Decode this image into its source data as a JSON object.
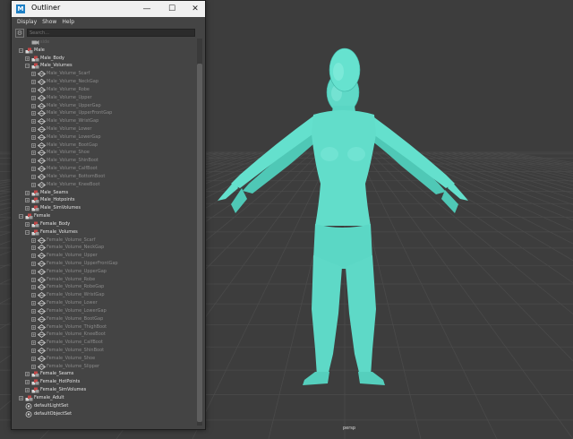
{
  "window": {
    "title": "Outliner",
    "app_icon": "M",
    "minimize_glyph": "—",
    "maximize_glyph": "☐",
    "close_glyph": "✕"
  },
  "menu": [
    "Display",
    "Show",
    "Help"
  ],
  "search": {
    "placeholder": "Search..."
  },
  "tree": [
    {
      "label": "side",
      "depth": 2,
      "icon": "camera-icon",
      "style": "ghost"
    },
    {
      "label": "Male",
      "depth": 1,
      "icon": "group-icon",
      "style": "bright",
      "expander": "-"
    },
    {
      "label": "Male_Body",
      "depth": 2,
      "icon": "group-icon",
      "style": "bright",
      "expander": "+"
    },
    {
      "label": "Male_Volumes",
      "depth": 2,
      "icon": "group-icon",
      "style": "bright",
      "expander": "-"
    },
    {
      "label": "Male_Volume_Scarf",
      "depth": 3,
      "icon": "mesh-icon",
      "style": "dim",
      "expander": "+"
    },
    {
      "label": "Male_Volume_NeckGap",
      "depth": 3,
      "icon": "mesh-icon",
      "style": "dim",
      "expander": "+"
    },
    {
      "label": "Male_Volume_Robe",
      "depth": 3,
      "icon": "mesh-icon",
      "style": "dim",
      "expander": "+"
    },
    {
      "label": "Male_Volume_Upper",
      "depth": 3,
      "icon": "mesh-icon",
      "style": "dim",
      "expander": "+"
    },
    {
      "label": "Male_Volume_UpperGap",
      "depth": 3,
      "icon": "mesh-icon",
      "style": "dim",
      "expander": "+"
    },
    {
      "label": "Male_Volume_UpperFrontGap",
      "depth": 3,
      "icon": "mesh-icon",
      "style": "dim",
      "expander": "+"
    },
    {
      "label": "Male_Volume_WristGap",
      "depth": 3,
      "icon": "mesh-icon",
      "style": "dim",
      "expander": "+"
    },
    {
      "label": "Male_Volume_Lower",
      "depth": 3,
      "icon": "mesh-icon",
      "style": "dim",
      "expander": "+"
    },
    {
      "label": "Male_Volume_LowerGap",
      "depth": 3,
      "icon": "mesh-icon",
      "style": "dim",
      "expander": "+"
    },
    {
      "label": "Male_Volume_BootGap",
      "depth": 3,
      "icon": "mesh-icon",
      "style": "dim",
      "expander": "+"
    },
    {
      "label": "Male_Volume_Shoe",
      "depth": 3,
      "icon": "mesh-icon",
      "style": "dim",
      "expander": "+"
    },
    {
      "label": "Male_Volume_ShinBoot",
      "depth": 3,
      "icon": "mesh-icon",
      "style": "dim",
      "expander": "+"
    },
    {
      "label": "Male_Volume_CalfBoot",
      "depth": 3,
      "icon": "mesh-icon",
      "style": "dim",
      "expander": "+"
    },
    {
      "label": "Male_Volume_BottomBoot",
      "depth": 3,
      "icon": "mesh-icon",
      "style": "dim",
      "expander": "+"
    },
    {
      "label": "Male_Volume_KneeBoot",
      "depth": 3,
      "icon": "mesh-icon",
      "style": "dim",
      "expander": "+"
    },
    {
      "label": "Male_Seams",
      "depth": 2,
      "icon": "group-icon",
      "style": "bright",
      "expander": "+"
    },
    {
      "label": "Male_Hotpoints",
      "depth": 2,
      "icon": "group-icon",
      "style": "bright",
      "expander": "+"
    },
    {
      "label": "Male_SimVolumes",
      "depth": 2,
      "icon": "group-icon",
      "style": "bright",
      "expander": "+"
    },
    {
      "label": "Female",
      "depth": 1,
      "icon": "group-icon",
      "style": "bright",
      "expander": "-"
    },
    {
      "label": "Female_Body",
      "depth": 2,
      "icon": "group-icon",
      "style": "bright",
      "expander": "+"
    },
    {
      "label": "Female_Volumes",
      "depth": 2,
      "icon": "group-icon",
      "style": "bright",
      "expander": "-"
    },
    {
      "label": "Female_Volume_Scarf",
      "depth": 3,
      "icon": "mesh-icon",
      "style": "dim",
      "expander": "+"
    },
    {
      "label": "Female_Volume_NeckGap",
      "depth": 3,
      "icon": "mesh-icon",
      "style": "dim",
      "expander": "+"
    },
    {
      "label": "Female_Volume_Upper",
      "depth": 3,
      "icon": "mesh-icon",
      "style": "dim",
      "expander": "+"
    },
    {
      "label": "Female_Volume_UpperFrontGap",
      "depth": 3,
      "icon": "mesh-icon",
      "style": "dim",
      "expander": "+"
    },
    {
      "label": "Female_Volume_UpperGap",
      "depth": 3,
      "icon": "mesh-icon",
      "style": "dim",
      "expander": "+"
    },
    {
      "label": "Female_Volume_Robe",
      "depth": 3,
      "icon": "mesh-icon",
      "style": "dim",
      "expander": "+"
    },
    {
      "label": "Female_Volume_RobeGap",
      "depth": 3,
      "icon": "mesh-icon",
      "style": "dim",
      "expander": "+"
    },
    {
      "label": "Female_Volume_WristGap",
      "depth": 3,
      "icon": "mesh-icon",
      "style": "dim",
      "expander": "+"
    },
    {
      "label": "Female_Volume_Lower",
      "depth": 3,
      "icon": "mesh-icon",
      "style": "dim",
      "expander": "+"
    },
    {
      "label": "Female_Volume_LowerGap",
      "depth": 3,
      "icon": "mesh-icon",
      "style": "dim",
      "expander": "+"
    },
    {
      "label": "Female_Volume_BootGap",
      "depth": 3,
      "icon": "mesh-icon",
      "style": "dim",
      "expander": "+"
    },
    {
      "label": "Female_Volume_ThighBoot",
      "depth": 3,
      "icon": "mesh-icon",
      "style": "dim",
      "expander": "+"
    },
    {
      "label": "Female_Volume_KneeBoot",
      "depth": 3,
      "icon": "mesh-icon",
      "style": "dim",
      "expander": "+"
    },
    {
      "label": "Female_Volume_CalfBoot",
      "depth": 3,
      "icon": "mesh-icon",
      "style": "dim",
      "expander": "+"
    },
    {
      "label": "Female_Volume_ShinBoot",
      "depth": 3,
      "icon": "mesh-icon",
      "style": "dim",
      "expander": "+"
    },
    {
      "label": "Female_Volume_Shoe",
      "depth": 3,
      "icon": "mesh-icon",
      "style": "dim",
      "expander": "+"
    },
    {
      "label": "Female_Volume_Slipper",
      "depth": 3,
      "icon": "mesh-icon",
      "style": "dim",
      "expander": "+"
    },
    {
      "label": "Female_Seams",
      "depth": 2,
      "icon": "group-icon",
      "style": "bright",
      "expander": "+"
    },
    {
      "label": "Female_HotPoints",
      "depth": 2,
      "icon": "group-icon",
      "style": "bright",
      "expander": "+"
    },
    {
      "label": "Female_SimVolumes",
      "depth": 2,
      "icon": "group-icon",
      "style": "bright",
      "expander": "+"
    },
    {
      "label": "Female_Adult",
      "depth": 1,
      "icon": "group-icon",
      "style": "bright",
      "expander": "+"
    },
    {
      "label": "defaultLightSet",
      "depth": 1,
      "icon": "set-icon",
      "style": "bright"
    },
    {
      "label": "defaultObjectSet",
      "depth": 1,
      "icon": "set-icon",
      "style": "bright"
    }
  ],
  "viewport": {
    "camera_label": "persp"
  },
  "colors": {
    "mesh": "#5ee0cc",
    "arrow": "#e8423a",
    "grid": "#4a4a4a",
    "background": "#3d3d3d"
  }
}
